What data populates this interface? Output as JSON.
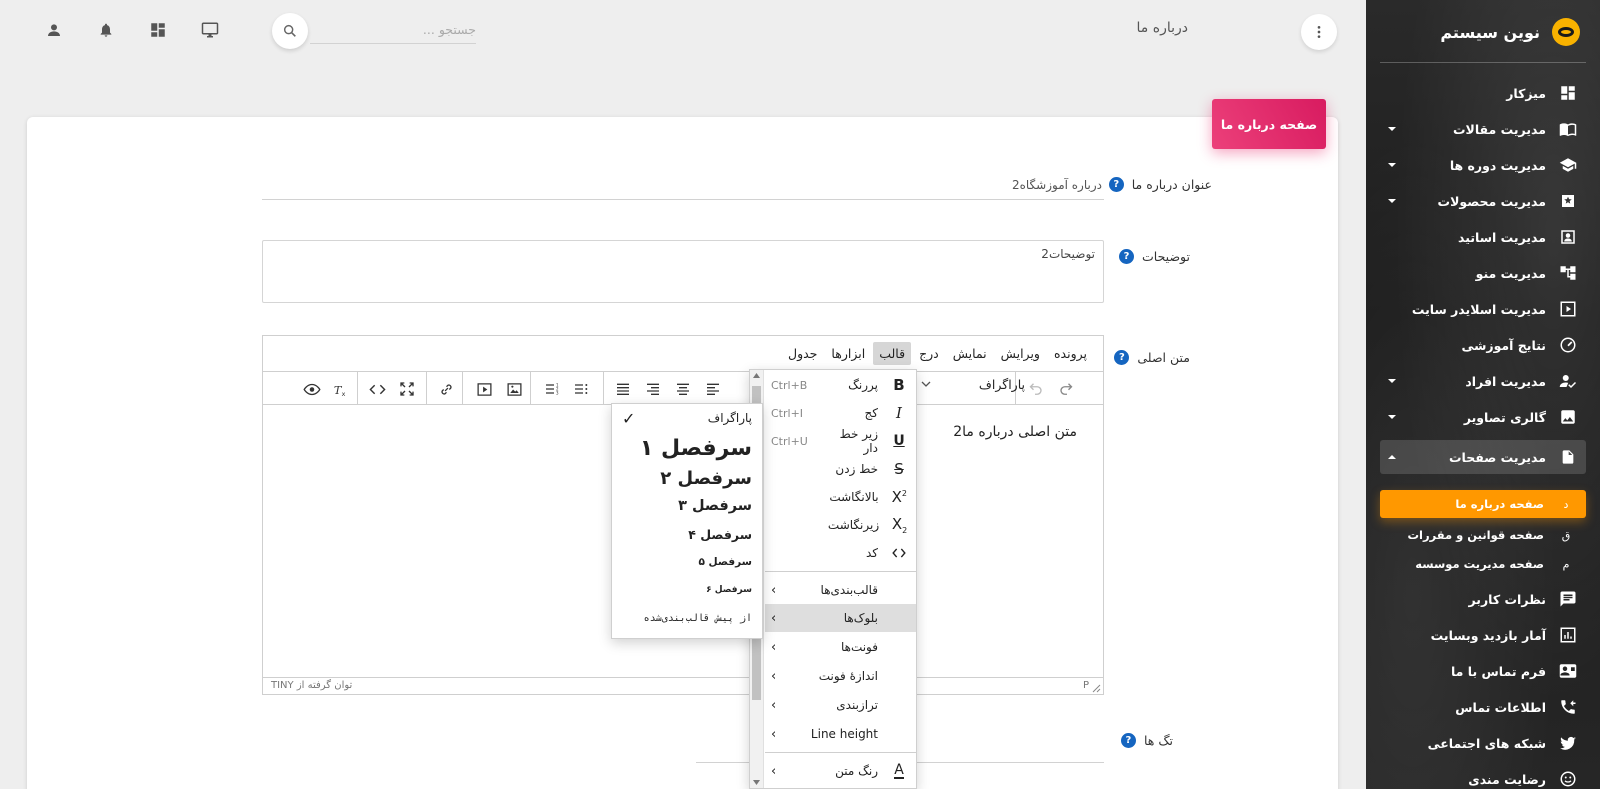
{
  "brand": {
    "title": "نوین سیستم"
  },
  "sidebar": {
    "items": [
      {
        "label": "میزکار",
        "icon": "dashboard-icon",
        "has_children": false
      },
      {
        "label": "مدیریت مقالات",
        "icon": "book-icon",
        "has_children": true
      },
      {
        "label": "مدیریت دوره ها",
        "icon": "school-icon",
        "has_children": true
      },
      {
        "label": "مدیریت محصولات",
        "icon": "product-icon",
        "has_children": true
      },
      {
        "label": "مدیریت اساتید",
        "icon": "contact-card-icon",
        "has_children": false
      },
      {
        "label": "مدیریت منو",
        "icon": "menu-tree-icon",
        "has_children": false
      },
      {
        "label": "مدیریت اسلایدر سایت",
        "icon": "slider-icon",
        "has_children": false
      },
      {
        "label": "نتایج آموزشی",
        "icon": "speedometer-icon",
        "has_children": false
      },
      {
        "label": "مدیریت افراد",
        "icon": "user-check-icon",
        "has_children": true
      },
      {
        "label": "گالری تصاویر",
        "icon": "image-icon",
        "has_children": true
      },
      {
        "label": "مدیریت صفحات",
        "icon": "page-icon",
        "has_children": true,
        "open": true
      }
    ],
    "subitems": [
      {
        "abbr": "د",
        "label": "صفحه درباره ما",
        "active": true
      },
      {
        "abbr": "ق",
        "label": "صفحه قوانین و مقررات",
        "active": false
      },
      {
        "abbr": "م",
        "label": "صفحه مدیریت موسسه",
        "active": false
      }
    ],
    "items_after": [
      {
        "label": "نظرات کاربر",
        "icon": "comment-icon"
      },
      {
        "label": "آمار بازدید وبسایت",
        "icon": "chart-icon"
      },
      {
        "label": "فرم تماس با ما",
        "icon": "contact-mail-icon"
      },
      {
        "label": "اطلاعات تماس",
        "icon": "phone-icon"
      },
      {
        "label": "شبکه های اجتماعی",
        "icon": "twitter-icon"
      },
      {
        "label": "رضایت مندی",
        "icon": "smiley-icon"
      }
    ]
  },
  "topbar": {
    "title": "درباره ما",
    "search_placeholder": "جستجو ..."
  },
  "card": {
    "header": "صفحه درباره ما"
  },
  "form": {
    "title_label": "عنوان درباره ما",
    "title_value": "درباره آموزشگاه2",
    "desc_label": "توضیحات",
    "desc_value": "توضیحات2",
    "content_label": "متن اصلی",
    "tags_label": "تگ ها"
  },
  "editor": {
    "menubar": [
      "پرونده",
      "ویرایش",
      "نمایش",
      "درج",
      "قالب",
      "ابزارها",
      "جدول"
    ],
    "active_menu": "قالب",
    "block_select": "پاراگراف",
    "content": "متن اصلی درباره ما2",
    "status_path": "P",
    "status_brand": "توان گرفته از TINY"
  },
  "format_menu": {
    "items": [
      {
        "label": "پررنگ",
        "shortcut": "Ctrl+B",
        "icon": "bold-icon"
      },
      {
        "label": "کج",
        "shortcut": "Ctrl+I",
        "icon": "italic-icon"
      },
      {
        "label": "زیر خط دار",
        "shortcut": "Ctrl+U",
        "icon": "underline-icon"
      },
      {
        "label": "خط زدن",
        "shortcut": "",
        "icon": "strikethrough-icon"
      },
      {
        "label": "بالانگاشت",
        "shortcut": "",
        "icon": "superscript-icon"
      },
      {
        "label": "زیرنگاشت",
        "shortcut": "",
        "icon": "subscript-icon"
      },
      {
        "label": "کد",
        "shortcut": "",
        "icon": "code-icon"
      }
    ],
    "submenus": [
      {
        "label": "قالب‌بندی‌ها",
        "hover": false
      },
      {
        "label": "بلوک‌ها",
        "hover": true
      },
      {
        "label": "فونت‌ها",
        "hover": false
      },
      {
        "label": "اندازهٔ فونت",
        "hover": false
      },
      {
        "label": "ترازبندی",
        "hover": false
      },
      {
        "label": "Line height",
        "hover": false
      }
    ],
    "last": {
      "label": "رنگ متن",
      "icon": "text-color-icon"
    }
  },
  "blocks_menu": {
    "items": [
      {
        "label": "پاراگراف",
        "checked": true
      },
      {
        "label": "سرفصل ۱",
        "checked": false
      },
      {
        "label": "سرفصل ۲",
        "checked": false
      },
      {
        "label": "سرفصل ۳",
        "checked": false
      },
      {
        "label": "سرفصل ۴",
        "checked": false
      },
      {
        "label": "سرفصل ۵",
        "checked": false
      },
      {
        "label": "سرفصل ۶",
        "checked": false
      },
      {
        "label": "از پیش قالب‌بندی‌شده",
        "checked": false
      }
    ]
  },
  "colors": {
    "accent_orange": "#ff9800",
    "header_pink": "#e91e63",
    "help_blue": "#1565c0",
    "sidebar_dark": "#222222"
  }
}
